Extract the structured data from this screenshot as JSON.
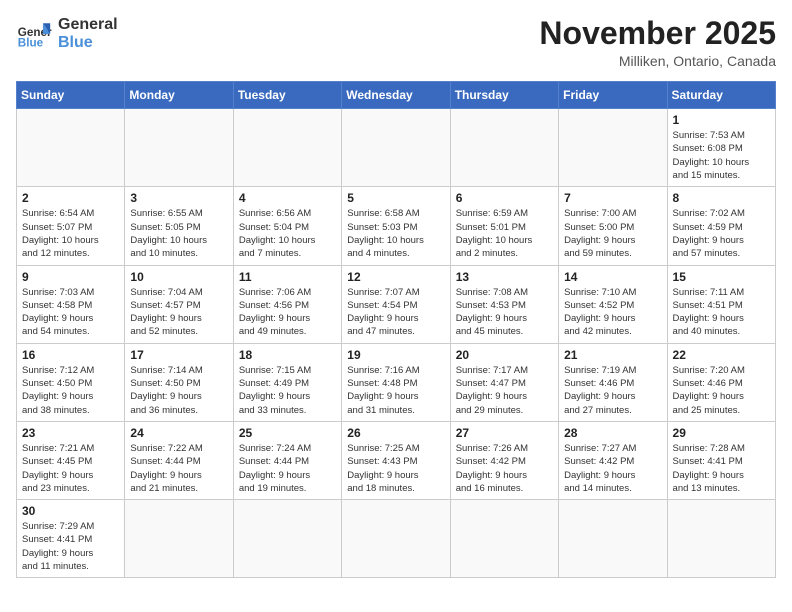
{
  "header": {
    "logo_general": "General",
    "logo_blue": "Blue",
    "month": "November 2025",
    "location": "Milliken, Ontario, Canada"
  },
  "weekdays": [
    "Sunday",
    "Monday",
    "Tuesday",
    "Wednesday",
    "Thursday",
    "Friday",
    "Saturday"
  ],
  "weeks": [
    [
      {
        "day": "",
        "info": ""
      },
      {
        "day": "",
        "info": ""
      },
      {
        "day": "",
        "info": ""
      },
      {
        "day": "",
        "info": ""
      },
      {
        "day": "",
        "info": ""
      },
      {
        "day": "",
        "info": ""
      },
      {
        "day": "1",
        "info": "Sunrise: 7:53 AM\nSunset: 6:08 PM\nDaylight: 10 hours\nand 15 minutes."
      }
    ],
    [
      {
        "day": "2",
        "info": "Sunrise: 6:54 AM\nSunset: 5:07 PM\nDaylight: 10 hours\nand 12 minutes."
      },
      {
        "day": "3",
        "info": "Sunrise: 6:55 AM\nSunset: 5:05 PM\nDaylight: 10 hours\nand 10 minutes."
      },
      {
        "day": "4",
        "info": "Sunrise: 6:56 AM\nSunset: 5:04 PM\nDaylight: 10 hours\nand 7 minutes."
      },
      {
        "day": "5",
        "info": "Sunrise: 6:58 AM\nSunset: 5:03 PM\nDaylight: 10 hours\nand 4 minutes."
      },
      {
        "day": "6",
        "info": "Sunrise: 6:59 AM\nSunset: 5:01 PM\nDaylight: 10 hours\nand 2 minutes."
      },
      {
        "day": "7",
        "info": "Sunrise: 7:00 AM\nSunset: 5:00 PM\nDaylight: 9 hours\nand 59 minutes."
      },
      {
        "day": "8",
        "info": "Sunrise: 7:02 AM\nSunset: 4:59 PM\nDaylight: 9 hours\nand 57 minutes."
      }
    ],
    [
      {
        "day": "9",
        "info": "Sunrise: 7:03 AM\nSunset: 4:58 PM\nDaylight: 9 hours\nand 54 minutes."
      },
      {
        "day": "10",
        "info": "Sunrise: 7:04 AM\nSunset: 4:57 PM\nDaylight: 9 hours\nand 52 minutes."
      },
      {
        "day": "11",
        "info": "Sunrise: 7:06 AM\nSunset: 4:56 PM\nDaylight: 9 hours\nand 49 minutes."
      },
      {
        "day": "12",
        "info": "Sunrise: 7:07 AM\nSunset: 4:54 PM\nDaylight: 9 hours\nand 47 minutes."
      },
      {
        "day": "13",
        "info": "Sunrise: 7:08 AM\nSunset: 4:53 PM\nDaylight: 9 hours\nand 45 minutes."
      },
      {
        "day": "14",
        "info": "Sunrise: 7:10 AM\nSunset: 4:52 PM\nDaylight: 9 hours\nand 42 minutes."
      },
      {
        "day": "15",
        "info": "Sunrise: 7:11 AM\nSunset: 4:51 PM\nDaylight: 9 hours\nand 40 minutes."
      }
    ],
    [
      {
        "day": "16",
        "info": "Sunrise: 7:12 AM\nSunset: 4:50 PM\nDaylight: 9 hours\nand 38 minutes."
      },
      {
        "day": "17",
        "info": "Sunrise: 7:14 AM\nSunset: 4:50 PM\nDaylight: 9 hours\nand 36 minutes."
      },
      {
        "day": "18",
        "info": "Sunrise: 7:15 AM\nSunset: 4:49 PM\nDaylight: 9 hours\nand 33 minutes."
      },
      {
        "day": "19",
        "info": "Sunrise: 7:16 AM\nSunset: 4:48 PM\nDaylight: 9 hours\nand 31 minutes."
      },
      {
        "day": "20",
        "info": "Sunrise: 7:17 AM\nSunset: 4:47 PM\nDaylight: 9 hours\nand 29 minutes."
      },
      {
        "day": "21",
        "info": "Sunrise: 7:19 AM\nSunset: 4:46 PM\nDaylight: 9 hours\nand 27 minutes."
      },
      {
        "day": "22",
        "info": "Sunrise: 7:20 AM\nSunset: 4:46 PM\nDaylight: 9 hours\nand 25 minutes."
      }
    ],
    [
      {
        "day": "23",
        "info": "Sunrise: 7:21 AM\nSunset: 4:45 PM\nDaylight: 9 hours\nand 23 minutes."
      },
      {
        "day": "24",
        "info": "Sunrise: 7:22 AM\nSunset: 4:44 PM\nDaylight: 9 hours\nand 21 minutes."
      },
      {
        "day": "25",
        "info": "Sunrise: 7:24 AM\nSunset: 4:44 PM\nDaylight: 9 hours\nand 19 minutes."
      },
      {
        "day": "26",
        "info": "Sunrise: 7:25 AM\nSunset: 4:43 PM\nDaylight: 9 hours\nand 18 minutes."
      },
      {
        "day": "27",
        "info": "Sunrise: 7:26 AM\nSunset: 4:42 PM\nDaylight: 9 hours\nand 16 minutes."
      },
      {
        "day": "28",
        "info": "Sunrise: 7:27 AM\nSunset: 4:42 PM\nDaylight: 9 hours\nand 14 minutes."
      },
      {
        "day": "29",
        "info": "Sunrise: 7:28 AM\nSunset: 4:41 PM\nDaylight: 9 hours\nand 13 minutes."
      }
    ],
    [
      {
        "day": "30",
        "info": "Sunrise: 7:29 AM\nSunset: 4:41 PM\nDaylight: 9 hours\nand 11 minutes."
      },
      {
        "day": "",
        "info": ""
      },
      {
        "day": "",
        "info": ""
      },
      {
        "day": "",
        "info": ""
      },
      {
        "day": "",
        "info": ""
      },
      {
        "day": "",
        "info": ""
      },
      {
        "day": "",
        "info": ""
      }
    ]
  ]
}
